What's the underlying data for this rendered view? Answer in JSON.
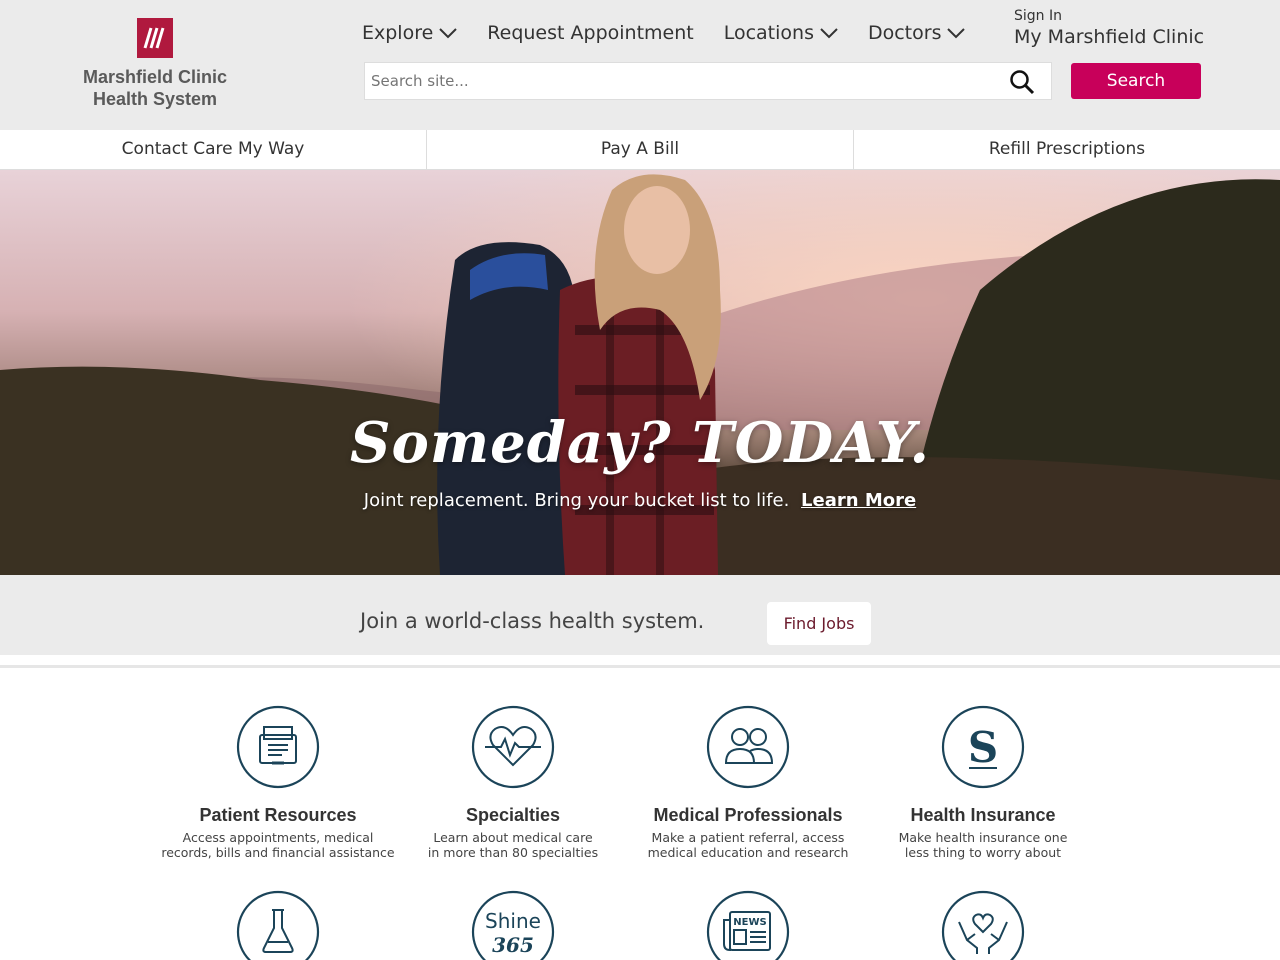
{
  "brand": {
    "logo_line1": "Marshfield Clinic",
    "logo_line2": "Health System",
    "accent": "#c8005a",
    "logo_color": "#b0193e",
    "icon_color": "#1b4459"
  },
  "nav": {
    "items": [
      {
        "label": "Explore",
        "dropdown": true
      },
      {
        "label": "Request Appointment",
        "dropdown": false
      },
      {
        "label": "Locations",
        "dropdown": true
      },
      {
        "label": "Doctors",
        "dropdown": true
      }
    ],
    "sign_in_small": "Sign In",
    "sign_in_big": "My Marshfield Clinic"
  },
  "search": {
    "placeholder": "Search site...",
    "value": "",
    "button_label": "Search"
  },
  "quick_links": [
    {
      "label": "Contact Care My Way"
    },
    {
      "label": "Pay A Bill"
    },
    {
      "label": "Refill Prescriptions"
    }
  ],
  "hero": {
    "headline": "Someday? TODAY.",
    "subtext": "Joint replacement. Bring your bucket list to life.",
    "link_label": "Learn More"
  },
  "jobs": {
    "text": "Join a world-class health system.",
    "button_label": "Find Jobs"
  },
  "cards": [
    {
      "title": "Patient Resources",
      "desc1": "Access appointments, medical",
      "desc2": "records, bills and financial assistance",
      "icon": "file-drawer-icon"
    },
    {
      "title": "Specialties",
      "desc1": "Learn about medical care",
      "desc2": "in more than 80 specialties",
      "icon": "heart-pulse-icon"
    },
    {
      "title": "Medical Professionals",
      "desc1": "Make a patient referral, access",
      "desc2": "medical education and research",
      "icon": "people-icon"
    },
    {
      "title": "Health Insurance",
      "desc1": "Make health insurance one",
      "desc2": "less thing to worry about",
      "icon": "security-health-plan-icon"
    }
  ],
  "cards_row2": [
    {
      "icon": "flask-icon"
    },
    {
      "icon": "shine-365-icon",
      "text_top": "Shine",
      "text_bottom": "365"
    },
    {
      "icon": "news-icon",
      "text": "NEWS"
    },
    {
      "icon": "hands-heart-icon"
    }
  ]
}
